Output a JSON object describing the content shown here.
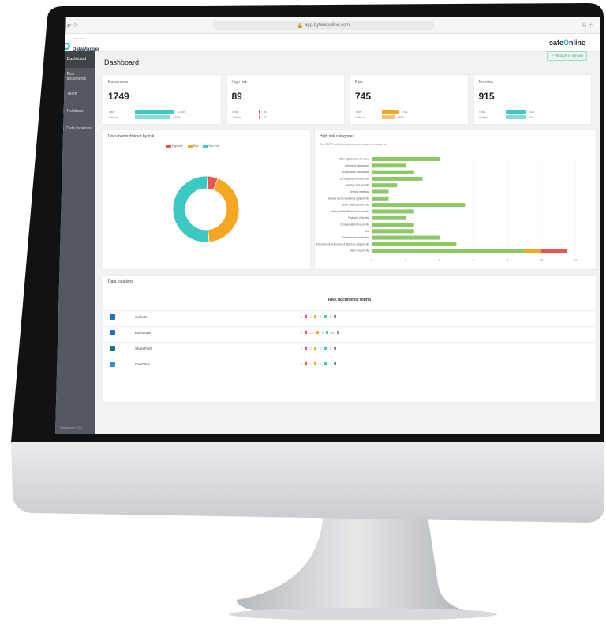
{
  "browser": {
    "url": "app.bytafeonline.com"
  },
  "app": {
    "logo_small": "bytafeonline",
    "logo_name": "DataMapper",
    "brand": {
      "part1": "safe",
      "o": "O",
      "part2": "nline"
    },
    "sync_status": "✓ All tools is synced"
  },
  "sidebar": {
    "items": [
      {
        "icon": "dashboard-icon",
        "label": "Dashboard",
        "active": true
      },
      {
        "icon": "document-icon",
        "label": "Risk documents",
        "active": false
      },
      {
        "icon": "team-icon",
        "label": "Team",
        "active": false
      },
      {
        "icon": "folder-icon",
        "label": "Relations",
        "active": false
      },
      {
        "icon": "database-icon",
        "label": "Data locations",
        "active": false
      }
    ],
    "footer": "DataMapper 2023"
  },
  "dashboard": {
    "title": "Dashboard",
    "cards": [
      {
        "title": "Documents",
        "value": "1749",
        "total_label": "Total",
        "unique_label": "Unique",
        "total": "1749",
        "unique": "1549",
        "color": "#3cc9c3",
        "total_frac": 1.0,
        "unique_frac": 0.89
      },
      {
        "title": "High risk",
        "value": "89",
        "total_label": "Total",
        "unique_label": "Unique",
        "total": "89",
        "unique": "81",
        "color": "#ef5350",
        "total_frac": 0.05,
        "unique_frac": 0.05
      },
      {
        "title": "Risk",
        "value": "745",
        "total_label": "Total",
        "unique_label": "Unique",
        "total": "745",
        "unique": "556",
        "color": "#f5a623",
        "total_frac": 0.43,
        "unique_frac": 0.34
      },
      {
        "title": "Non-risk",
        "value": "915",
        "total_label": "Total",
        "unique_label": "Unique",
        "total": "915",
        "unique": "874",
        "color": "#3cc9c3",
        "total_frac": 0.52,
        "unique_frac": 0.5
      }
    ]
  },
  "donut": {
    "title": "Documents divided by risk",
    "legend": [
      {
        "name": "High risk",
        "color": "#ef5350"
      },
      {
        "name": "Risk",
        "color": "#f5a623"
      },
      {
        "name": "Non-risk",
        "color": "#3cc9c3"
      }
    ]
  },
  "hrc": {
    "title": "High risk categories",
    "subtitle": "The GDPR risk distribution across document categories",
    "x_ticks": [
      "0",
      "2",
      "4",
      "6",
      "8",
      "10",
      "12"
    ]
  },
  "data_locations": {
    "title": "Data locations",
    "column_header": "Risk documents found",
    "rows": [
      {
        "name": "Outlook",
        "icon": "outlook-icon",
        "icon_color": "#1f6fc4",
        "values": [
          "0",
          "0",
          "0",
          "0"
        ]
      },
      {
        "name": "Exchange",
        "icon": "exchange-icon",
        "icon_color": "#1f6fc4",
        "values": [
          "2",
          "20",
          "0",
          "82"
        ]
      },
      {
        "name": "SharePoint",
        "icon": "sharepoint-icon",
        "icon_color": "#0b7a75",
        "values": [
          "0",
          "0",
          "0",
          "0"
        ]
      },
      {
        "name": "OneDrive",
        "icon": "onedrive-icon",
        "icon_color": "#2f8fe0",
        "values": [
          "0",
          "0",
          "0",
          "0"
        ]
      }
    ]
  },
  "chart_data": [
    {
      "type": "pie",
      "title": "Documents divided by risk",
      "categories": [
        "High risk",
        "Risk",
        "Non-risk"
      ],
      "values": [
        89,
        745,
        915
      ]
    },
    {
      "type": "bar",
      "title": "High risk categories",
      "subtitle": "The GDPR risk distribution across document categories",
      "categories": [
        "Other applications for leave",
        "Articles of association",
        "Incorporation and bylaws",
        "Job application documents",
        "Invoices and receipts",
        "General meetings",
        "Service and consultancy agreements",
        "Grant related documents",
        "Personal identification documents",
        "Financial Overview",
        "Compensation documents",
        "CVs",
        "Employment termination",
        "Employment and board of directors agreements",
        "Other Documents"
      ],
      "series": [
        {
          "name": "Non-risk",
          "color": "#8bc866",
          "values": [
            4,
            2,
            2.5,
            3,
            1.5,
            1,
            1,
            5.5,
            2.5,
            2,
            2.5,
            2.5,
            4,
            5,
            9
          ]
        },
        {
          "name": "Risk",
          "color": "#f5a623",
          "values": [
            0,
            0,
            0,
            0,
            0,
            0,
            0,
            0,
            0,
            0,
            0,
            0,
            0,
            0,
            1
          ]
        },
        {
          "name": "High risk",
          "color": "#ef5350",
          "values": [
            0,
            0,
            0,
            0,
            0,
            0,
            0,
            0,
            0,
            0,
            0,
            0,
            0,
            0,
            1.5
          ]
        }
      ],
      "xlim": [
        0,
        12
      ]
    }
  ]
}
